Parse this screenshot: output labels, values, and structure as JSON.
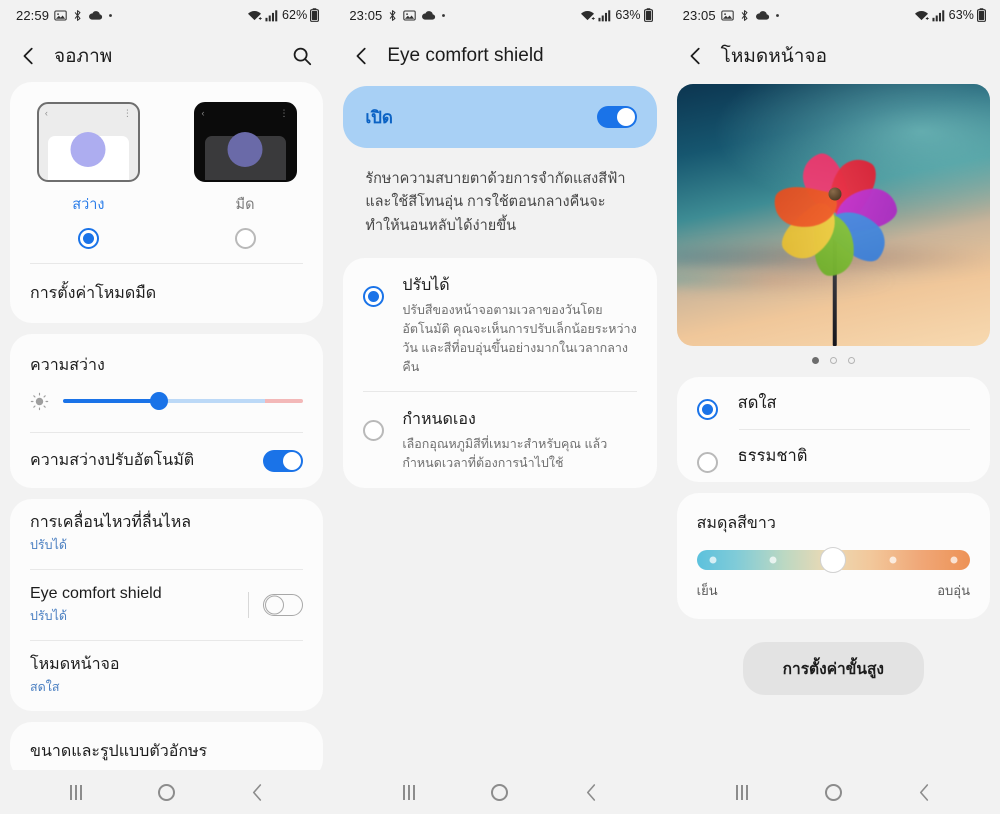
{
  "panels": {
    "left": {
      "status": {
        "time": "22:59",
        "battery": "62%",
        "icons": [
          "image-icon",
          "bluetooth-icon",
          "cloud-icon",
          "dot-icon"
        ],
        "wifi": "wifi-icon",
        "signal": "signal-icon",
        "battery_icon": "battery-icon"
      },
      "title": "จอภาพ",
      "search_icon": "search-icon",
      "back_icon": "back-arrow-icon",
      "theme": {
        "light_label": "สว่าง",
        "dark_label": "มืด",
        "light_selected": true,
        "dark_selected": false
      },
      "dark_mode_settings": "การตั้งค่าโหมดมืด",
      "brightness": {
        "title": "ความสว่าง",
        "value_pct": 40,
        "warn_start_pct": 84,
        "sun_icon": "brightness-icon"
      },
      "auto_brightness": {
        "label": "ความสว่างปรับอัตโนมัติ",
        "on": true
      },
      "items": [
        {
          "title": "การเคลื่อนไหวที่ลื่นไหล",
          "sub": "ปรับได้",
          "toggle": null
        },
        {
          "title": "Eye comfort shield",
          "sub": "ปรับได้",
          "toggle": false
        },
        {
          "title": "โหมดหน้าจอ",
          "sub": "สดใส",
          "toggle": null
        }
      ],
      "font_item": "ขนาดและรูปแบบตัวอักษร"
    },
    "mid": {
      "status": {
        "time": "23:05",
        "battery": "63%"
      },
      "title": "Eye comfort shield",
      "master": {
        "label": "เปิด",
        "on": true
      },
      "description": "รักษาความสบายตาด้วยการจำกัดแสงสีฟ้าและใช้สีโทนอุ่น การใช้ตอนกลางคืนจะทำให้นอนหลับได้ง่ายขึ้น",
      "options": [
        {
          "title": "ปรับได้",
          "sub": "ปรับสีของหน้าจอตามเวลาของวันโดยอัตโนมัติ คุณจะเห็นการปรับเล็กน้อยระหว่างวัน และสีที่อบอุ่นขึ้นอย่างมากในเวลากลางคืน",
          "selected": true
        },
        {
          "title": "กำหนดเอง",
          "sub": "เลือกอุณหภูมิสีที่เหมาะสำหรับคุณ แล้วกำหนดเวลาที่ต้องการนำไปใช้",
          "selected": false
        }
      ]
    },
    "right": {
      "status": {
        "time": "23:05",
        "battery": "63%"
      },
      "title": "โหมดหน้าจอ",
      "preview": {
        "alt": "pinwheel-preview",
        "page_dots": 3,
        "active_dot": 1
      },
      "options": [
        {
          "label": "สดใส",
          "selected": true
        },
        {
          "label": "ธรรมชาติ",
          "selected": false
        }
      ],
      "white_balance": {
        "title": "สมดุลสีขาว",
        "cool_label": "เย็น",
        "warm_label": "อบอุ่น",
        "value_pct": 50
      },
      "advanced_button": "การตั้งค่าขั้นสูง"
    }
  },
  "navbar": {
    "recents": "recents-icon",
    "home": "home-icon",
    "back": "back-icon"
  },
  "colors": {
    "accent": "#1a73e8",
    "link": "#4a7fc1",
    "card": "#fcfcfc",
    "bg": "#f2f2f2",
    "master_card": "#a8d0f5",
    "master_text": "#0b62c4"
  }
}
